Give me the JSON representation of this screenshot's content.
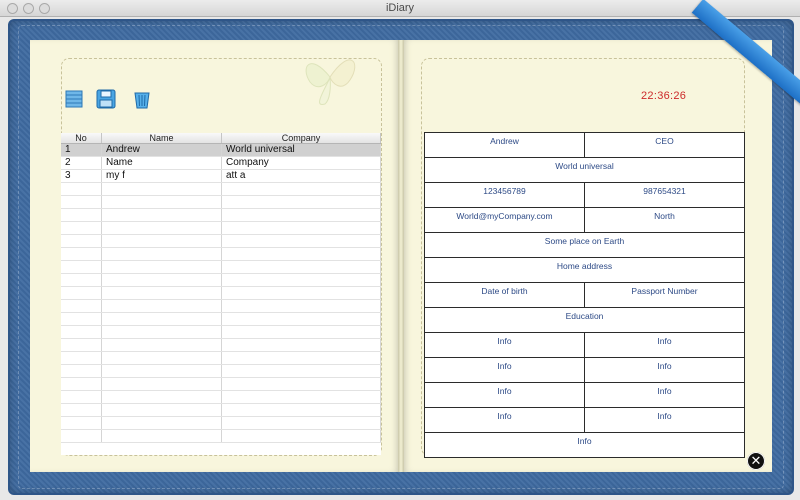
{
  "window": {
    "title": "iDiary"
  },
  "toolbar": {
    "list_icon": "list-icon",
    "save_icon": "floppy-disk-icon",
    "delete_icon": "trash-icon"
  },
  "table": {
    "headers": [
      "No",
      "Name",
      "Company"
    ],
    "rows": [
      {
        "no": "1",
        "name": "Andrew",
        "company": "World universal",
        "selected": true
      },
      {
        "no": "2",
        "name": "Name",
        "company": "Company",
        "selected": false
      },
      {
        "no": "3",
        "name": "my f",
        "company": "att a",
        "selected": false
      }
    ]
  },
  "clock": "22:36:26",
  "form": {
    "rows": [
      [
        "Andrew",
        "CEO"
      ],
      [
        "World universal"
      ],
      [
        "123456789",
        "987654321"
      ],
      [
        "World@myCompany.com",
        "North"
      ],
      [
        "Some place on Earth"
      ],
      [
        "Home address"
      ],
      [
        "Date of birth",
        "Passport Number"
      ],
      [
        "Education"
      ],
      [
        "Info",
        "Info"
      ],
      [
        "Info",
        "Info"
      ],
      [
        "Info",
        "Info"
      ],
      [
        "Info",
        "Info"
      ],
      [
        "Info"
      ]
    ]
  },
  "colors": {
    "cover": "#3e6aa0",
    "page": "#f8f6dd",
    "ribbon": "#2a86d8",
    "clock": "#cc2a2a",
    "form_text": "#2d4a86"
  },
  "close_icon": "close-circle-icon"
}
